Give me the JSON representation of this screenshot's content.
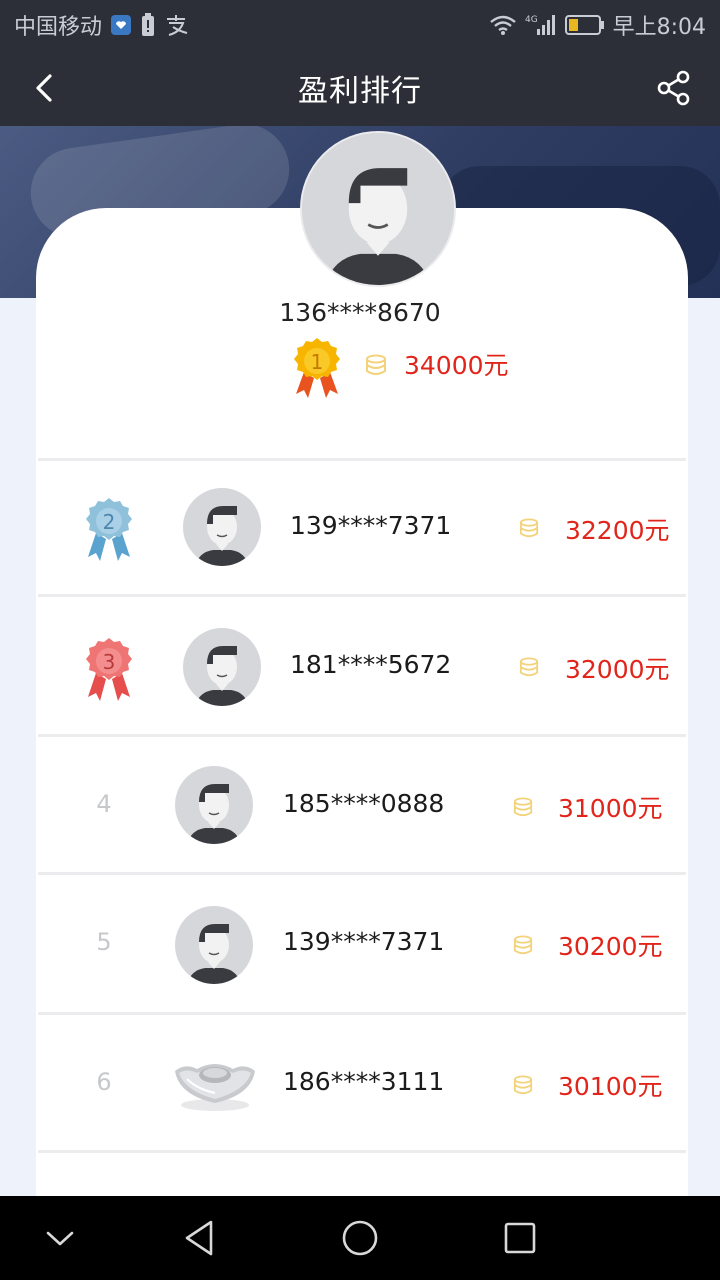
{
  "status_bar": {
    "carrier": "中国移动",
    "network": "4G",
    "time": "早上8:04",
    "icons": [
      "health-app-icon",
      "battery-saver-icon",
      "alipay-icon",
      "wifi-icon",
      "signal-icon",
      "battery-icon"
    ]
  },
  "header": {
    "title": "盈利排行",
    "back_icon": "chevron-left-icon",
    "share_icon": "share-icon"
  },
  "top_winner": {
    "rank": "1",
    "phone": "136****8670",
    "amount": "34000元"
  },
  "ranking": [
    {
      "rank": "2",
      "phone": "139****7371",
      "amount": "32200元",
      "badge": "silver-medal",
      "avatar": "default-avatar"
    },
    {
      "rank": "3",
      "phone": "181****5672",
      "amount": "32000元",
      "badge": "red-medal",
      "avatar": "default-avatar"
    },
    {
      "rank": "4",
      "phone": "185****0888",
      "amount": "31000元",
      "badge": "number",
      "avatar": "default-avatar"
    },
    {
      "rank": "5",
      "phone": "139****7371",
      "amount": "30200元",
      "badge": "number",
      "avatar": "default-avatar"
    },
    {
      "rank": "6",
      "phone": "186****3111",
      "amount": "30100元",
      "badge": "number",
      "avatar": "silver-ingot"
    }
  ],
  "colors": {
    "bar_bg": "#2c2f37",
    "amount_red": "#e1251b",
    "coin_gold": "#f2d27a",
    "gold_medal": "#f5b400",
    "silver_medal": "#8fc1db",
    "red_medal": "#ef7474"
  },
  "nav_bar": [
    "chevron-down-icon",
    "back-triangle-icon",
    "home-circle-icon",
    "recents-square-icon"
  ]
}
